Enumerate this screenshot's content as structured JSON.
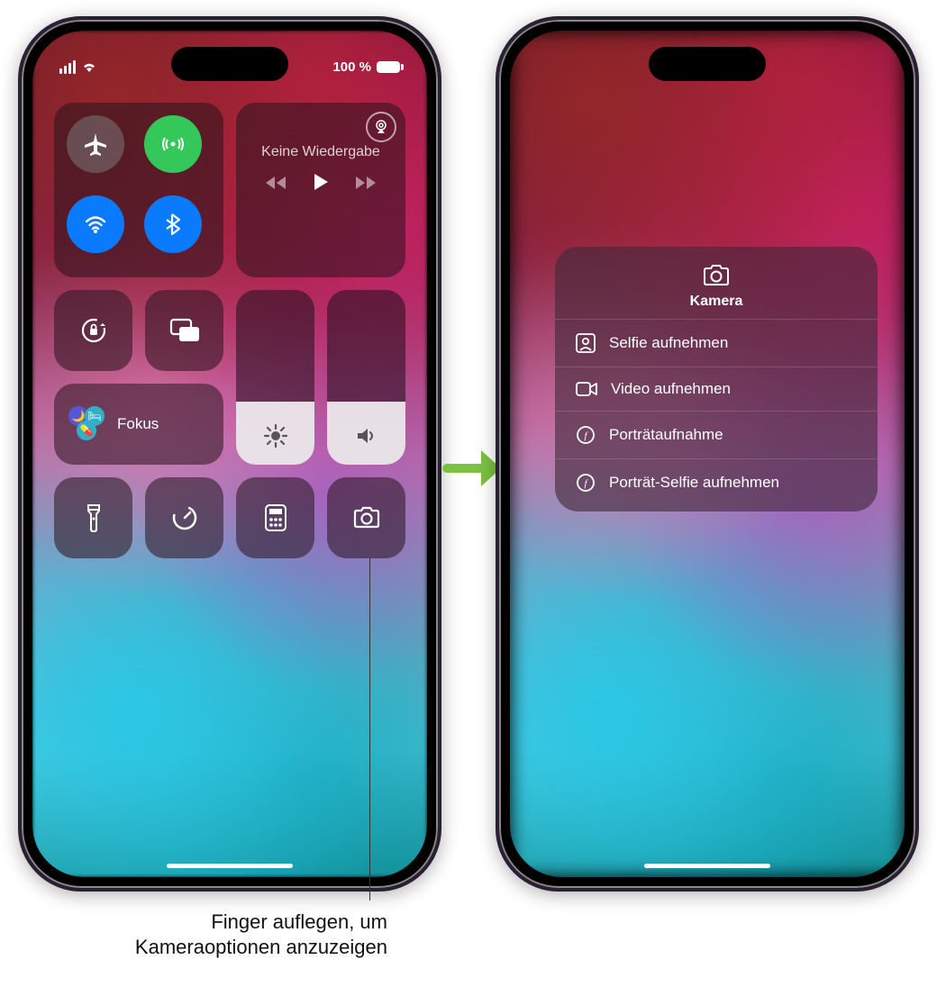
{
  "status": {
    "battery_text": "100 %"
  },
  "media": {
    "title": "Keine Wiedergabe"
  },
  "focus": {
    "label": "Fokus"
  },
  "sliders": {
    "brightness_pct": 36,
    "volume_pct": 36
  },
  "camera_menu": {
    "title": "Kamera",
    "items": [
      "Selfie aufnehmen",
      "Video aufnehmen",
      "Porträtaufnahme",
      "Porträt-Selfie aufnehmen"
    ]
  },
  "callout": {
    "line1": "Finger auflegen, um",
    "line2": "Kameraoptionen anzuzeigen"
  }
}
